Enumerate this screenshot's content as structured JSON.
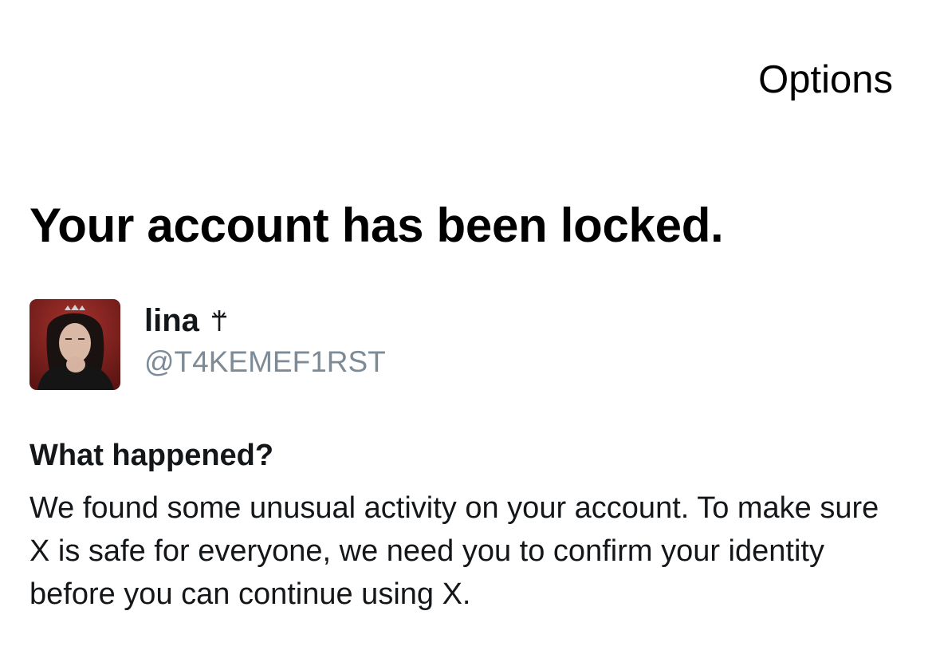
{
  "header": {
    "options_label": "Options"
  },
  "main": {
    "title": "Your account has been locked.",
    "user": {
      "display_name": "lina",
      "name_symbol": "cross-icon",
      "username": "@T4KEMEF1RST"
    },
    "section_heading": "What happened?",
    "body_text": "We found some unusual activity on your account. To make sure X is safe for everyone, we need you to confirm your identity before you can continue using X."
  },
  "colors": {
    "text_primary": "#14171a",
    "text_secondary": "#7d8b97",
    "background": "#ffffff"
  }
}
